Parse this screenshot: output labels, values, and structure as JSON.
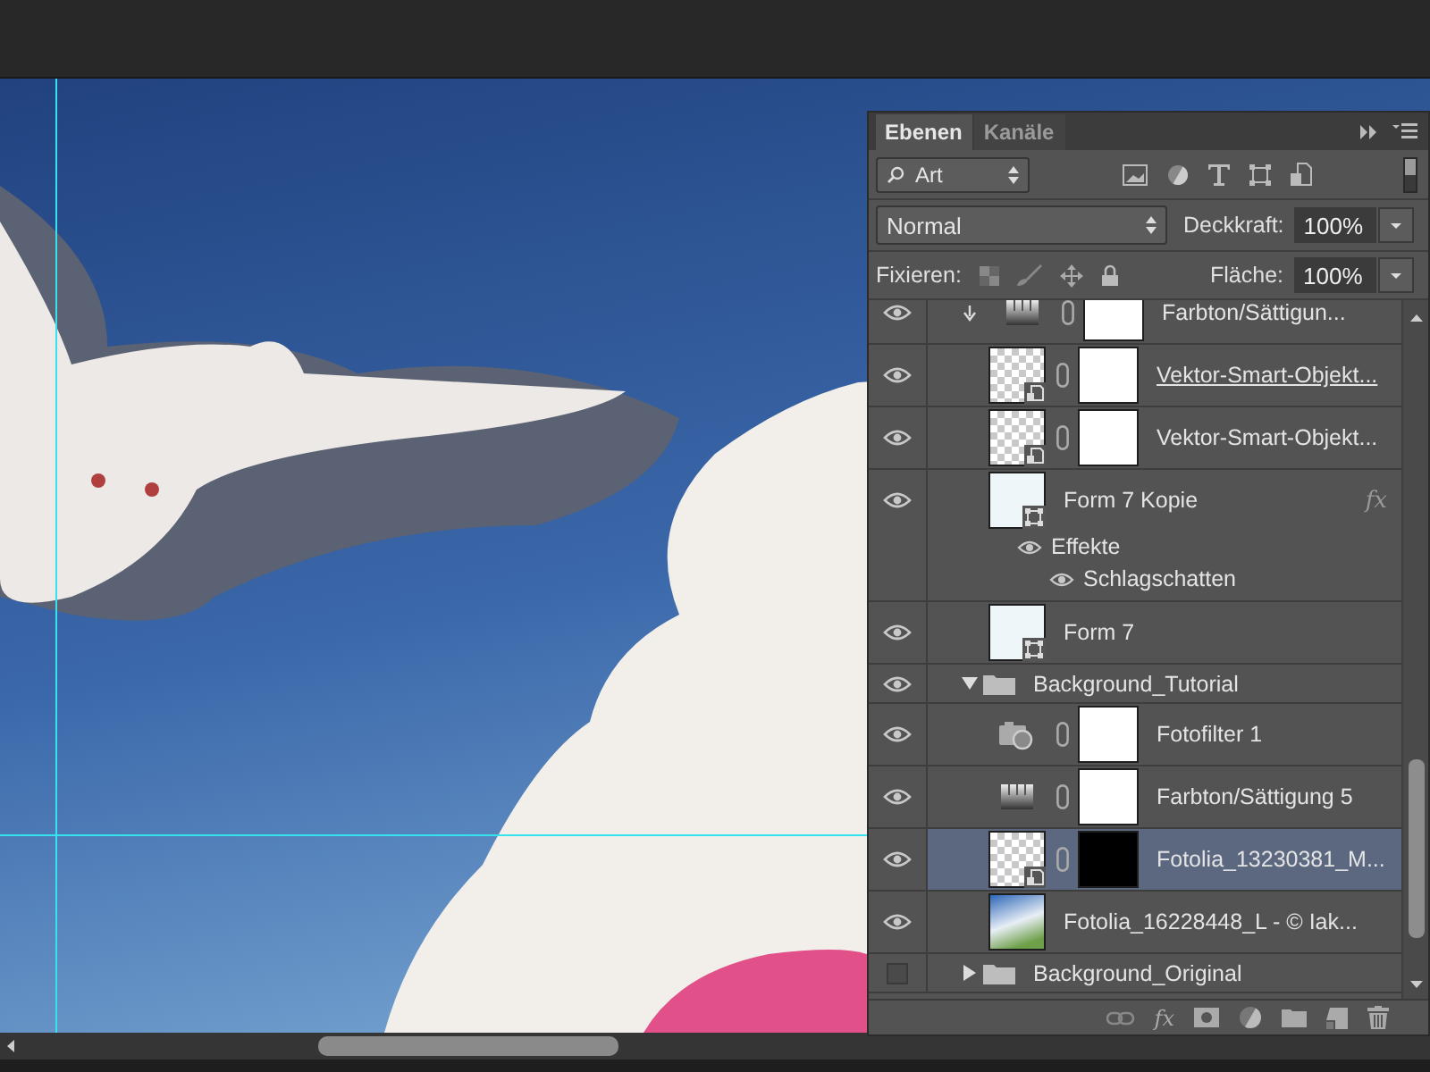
{
  "panel": {
    "tabs": [
      {
        "label": "Ebenen",
        "selected": true
      },
      {
        "label": "Kanäle",
        "selected": false
      }
    ],
    "filter": {
      "value": "Art"
    },
    "blend_mode": {
      "value": "Normal"
    },
    "opacity": {
      "label": "Deckkraft:",
      "value": "100%"
    },
    "lock": {
      "label": "Fixieren:"
    },
    "fill": {
      "label": "Fläche:",
      "value": "100%"
    },
    "layers": [
      {
        "kind": "hue-adjustment",
        "name": "Farbton/Sättigun...",
        "visible": true,
        "selected": false,
        "clipped": true,
        "underlined": false,
        "mask_filled": false
      },
      {
        "kind": "smart-object",
        "name": "Vektor-Smart-Objekt...",
        "visible": true,
        "selected": false,
        "clipped": false,
        "underlined": true,
        "mask_filled": false
      },
      {
        "kind": "smart-object",
        "name": "Vektor-Smart-Objekt...",
        "visible": true,
        "selected": false,
        "clipped": false,
        "underlined": false,
        "mask_filled": false
      },
      {
        "kind": "shape",
        "name": "Form 7 Kopie",
        "visible": true,
        "selected": false,
        "clipped": false,
        "underlined": false,
        "fx_badge": "fx",
        "effects": [
          {
            "label": "Effekte",
            "visible": true,
            "children": [
              {
                "label": "Schlagschatten",
                "visible": true
              }
            ]
          }
        ]
      },
      {
        "kind": "shape",
        "name": "Form 7",
        "visible": true,
        "selected": false,
        "clipped": false,
        "underlined": false
      },
      {
        "kind": "group",
        "name": "Background_Tutorial",
        "visible": true,
        "selected": false,
        "expanded": true,
        "children": [
          {
            "kind": "photo-filter",
            "name": "Fotofilter 1",
            "visible": true,
            "selected": false,
            "clipped": false,
            "underlined": false,
            "mask_filled": false
          },
          {
            "kind": "hue-adjustment",
            "name": "Farbton/Sättigung 5",
            "visible": true,
            "selected": false,
            "clipped": false,
            "underlined": false,
            "mask_filled": false
          },
          {
            "kind": "smart-object",
            "name": "Fotolia_13230381_M...",
            "visible": true,
            "selected": true,
            "clipped": false,
            "underlined": false,
            "mask_filled": true
          },
          {
            "kind": "photo",
            "name": "Fotolia_16228448_L - © Iak...",
            "visible": true,
            "selected": false,
            "clipped": false,
            "underlined": false
          }
        ]
      },
      {
        "kind": "group",
        "name": "Background_Original",
        "visible": false,
        "selected": false,
        "expanded": false
      }
    ],
    "toolbar": {
      "fx": "fx"
    }
  }
}
